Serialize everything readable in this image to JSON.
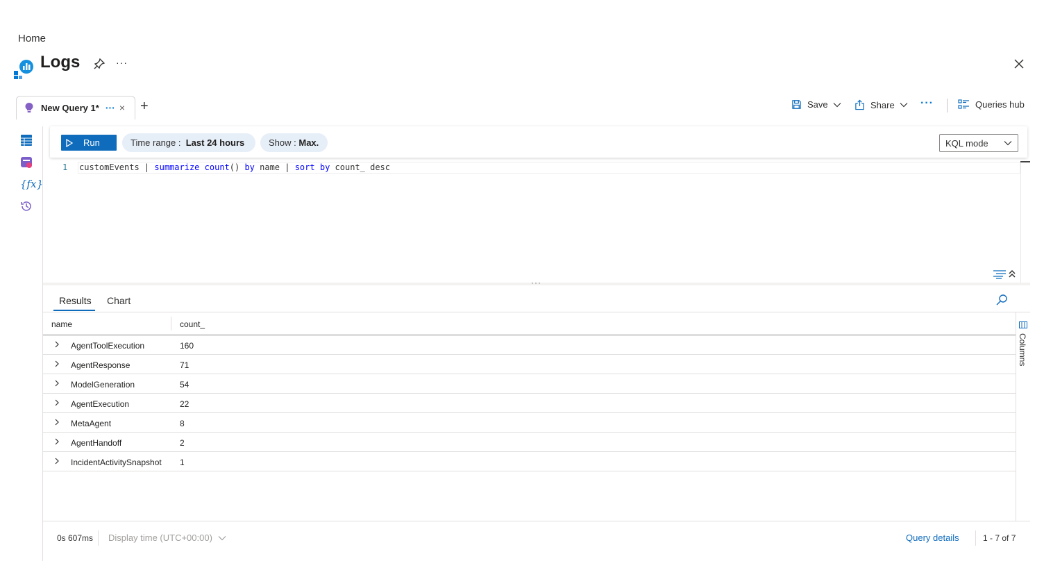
{
  "breadcrumb": {
    "home": "Home"
  },
  "header": {
    "title": "Logs",
    "more": "···"
  },
  "tabs": [
    {
      "label": "New Query 1*",
      "more": "···",
      "close": "×"
    }
  ],
  "add_tab": "+",
  "toolbar": {
    "save_label": "Save",
    "share_label": "Share",
    "more": "···",
    "queries_hub_label": "Queries hub"
  },
  "query_bar": {
    "run_label": "Run",
    "time_range_prefix": "Time range :",
    "time_range_value": "Last 24 hours",
    "show_prefix": "Show :",
    "show_value": "Max.",
    "mode_label": "KQL mode"
  },
  "editor": {
    "line_number": "1",
    "code_tokens": [
      {
        "text": "customEvents | ",
        "kw": false
      },
      {
        "text": "summarize",
        "kw": true
      },
      {
        "text": " ",
        "kw": false
      },
      {
        "text": "count",
        "kw": true
      },
      {
        "text": "() ",
        "kw": false
      },
      {
        "text": "by",
        "kw": true
      },
      {
        "text": " name | ",
        "kw": false
      },
      {
        "text": "sort",
        "kw": true
      },
      {
        "text": " ",
        "kw": false
      },
      {
        "text": "by",
        "kw": true
      },
      {
        "text": " count_ desc",
        "kw": false
      }
    ]
  },
  "splitter": "···",
  "results": {
    "tabs": {
      "results": "Results",
      "chart": "Chart"
    },
    "columns": [
      "name",
      "count_"
    ],
    "rows": [
      {
        "name": "AgentToolExecution",
        "count": "160"
      },
      {
        "name": "AgentResponse",
        "count": "71"
      },
      {
        "name": "ModelGeneration",
        "count": "54"
      },
      {
        "name": "AgentExecution",
        "count": "22"
      },
      {
        "name": "MetaAgent",
        "count": "8"
      },
      {
        "name": "AgentHandoff",
        "count": "2"
      },
      {
        "name": "IncidentActivitySnapshot",
        "count": "1"
      }
    ],
    "columns_panel_label": "Columns"
  },
  "footer": {
    "duration": "0s 607ms",
    "display_time": "Display time (UTC+00:00)",
    "query_details": "Query details",
    "paging": "1 - 7 of 7"
  },
  "colors": {
    "accent": "#0f6cbd",
    "pill_bg": "#e6eef8",
    "keyword": "#0000ff",
    "line_number": "#237893"
  },
  "icons": {
    "logo": "logs-analytics-icon",
    "pin": "pin-icon",
    "close": "close-icon",
    "bulb": "lightbulb-icon",
    "save": "save-icon",
    "share": "share-icon",
    "queries_hub": "queries-hub-icon",
    "rail": [
      "tables-icon",
      "queries-icon",
      "functions-icon",
      "history-icon"
    ],
    "search": "search-icon",
    "row_expand": "chevron-right-icon",
    "columns": "columns-icon"
  }
}
